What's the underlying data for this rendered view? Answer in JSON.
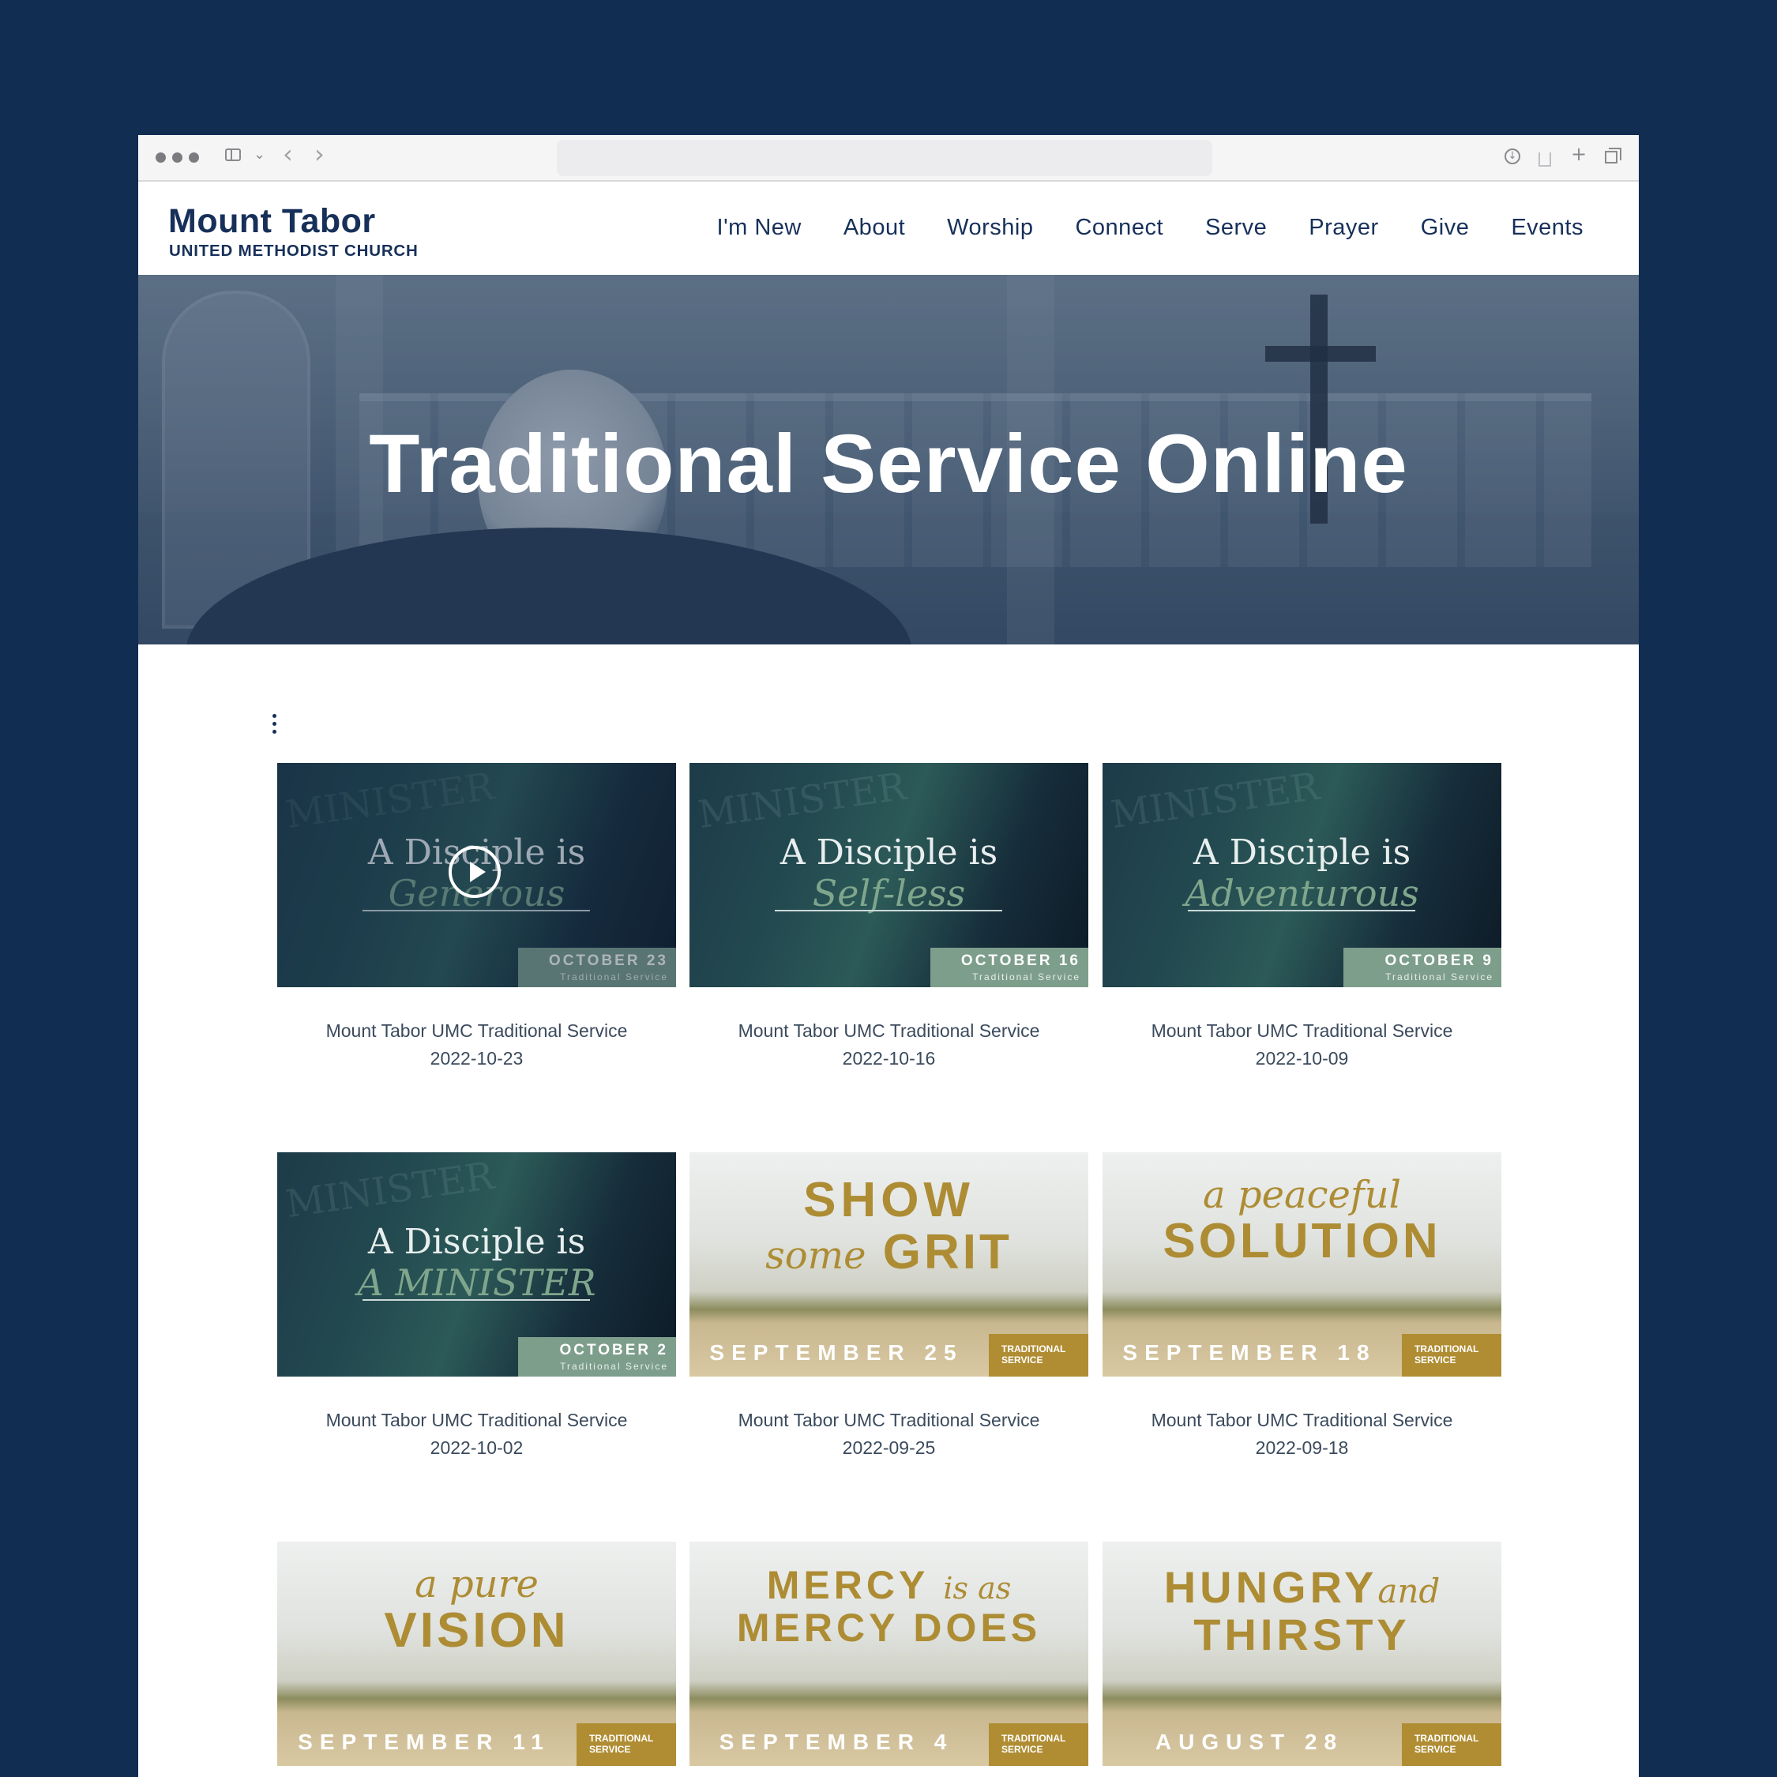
{
  "site": {
    "logo_main": "Mount Tabor",
    "logo_sub": "UNITED METHODIST CHURCH",
    "menu": [
      "I'm New",
      "About",
      "Worship",
      "Connect",
      "Serve",
      "Prayer",
      "Give",
      "Events"
    ]
  },
  "hero": {
    "title": "Traditional Service Online"
  },
  "colors": {
    "page_bg": "#112d52",
    "brand_navy": "#17305a",
    "gold": "#b08d33",
    "sage": "#7e9e8c"
  },
  "icons": [
    "more-vertical-icon",
    "play-icon",
    "sidebar-icon",
    "back-icon",
    "forward-icon",
    "download-icon",
    "share-icon",
    "new-tab-icon",
    "tabs-icon"
  ],
  "videos": [
    {
      "thumb": {
        "style": "dark",
        "title": "A Disciple is",
        "script": "Generous",
        "date": "OCTOBER 23",
        "sub": "Traditional Service"
      },
      "caption": "Mount Tabor UMC Traditional Service",
      "date": "2022-10-23"
    },
    {
      "thumb": {
        "style": "dark",
        "title": "A Disciple is",
        "script": "Self-less",
        "date": "OCTOBER 16",
        "sub": "Traditional Service"
      },
      "caption": "Mount Tabor UMC Traditional Service",
      "date": "2022-10-16"
    },
    {
      "thumb": {
        "style": "dark",
        "title": "A Disciple is",
        "script": "Adventurous",
        "date": "OCTOBER 9",
        "sub": "Traditional Service"
      },
      "caption": "Mount Tabor UMC Traditional Service",
      "date": "2022-10-09"
    },
    {
      "thumb": {
        "style": "dark",
        "title": "A Disciple is",
        "script": "A MINISTER",
        "date": "OCTOBER 2",
        "sub": "Traditional Service"
      },
      "caption": "Mount Tabor UMC Traditional Service",
      "date": "2022-10-02"
    },
    {
      "thumb": {
        "style": "light",
        "line1": "SHOW",
        "script": "some",
        "line2": "GRIT",
        "date": "SEPTEMBER 25",
        "badge": "TRADITIONAL SERVICE"
      },
      "caption": "Mount Tabor UMC Traditional Service",
      "date": "2022-09-25"
    },
    {
      "thumb": {
        "style": "light",
        "line1": "",
        "script": "a peaceful",
        "line2": "SOLUTION",
        "date": "SEPTEMBER 18",
        "badge": "TRADITIONAL SERVICE"
      },
      "caption": "Mount Tabor UMC Traditional Service",
      "date": "2022-09-18"
    },
    {
      "thumb": {
        "style": "light",
        "line1": "",
        "script": "a pure",
        "line2": "VISION",
        "date": "SEPTEMBER 11",
        "badge": "TRADITIONAL SERVICE"
      }
    },
    {
      "thumb": {
        "style": "light",
        "line1": "MERCY",
        "script": "is as",
        "line2": "MERCY DOES",
        "date": "SEPTEMBER 4",
        "badge": "TRADITIONAL SERVICE"
      }
    },
    {
      "thumb": {
        "style": "light",
        "line1": "HUNGRY",
        "script": "and",
        "line2": "THIRSTY",
        "date": "AUGUST 28",
        "badge": "TRADITIONAL SERVICE"
      }
    }
  ]
}
